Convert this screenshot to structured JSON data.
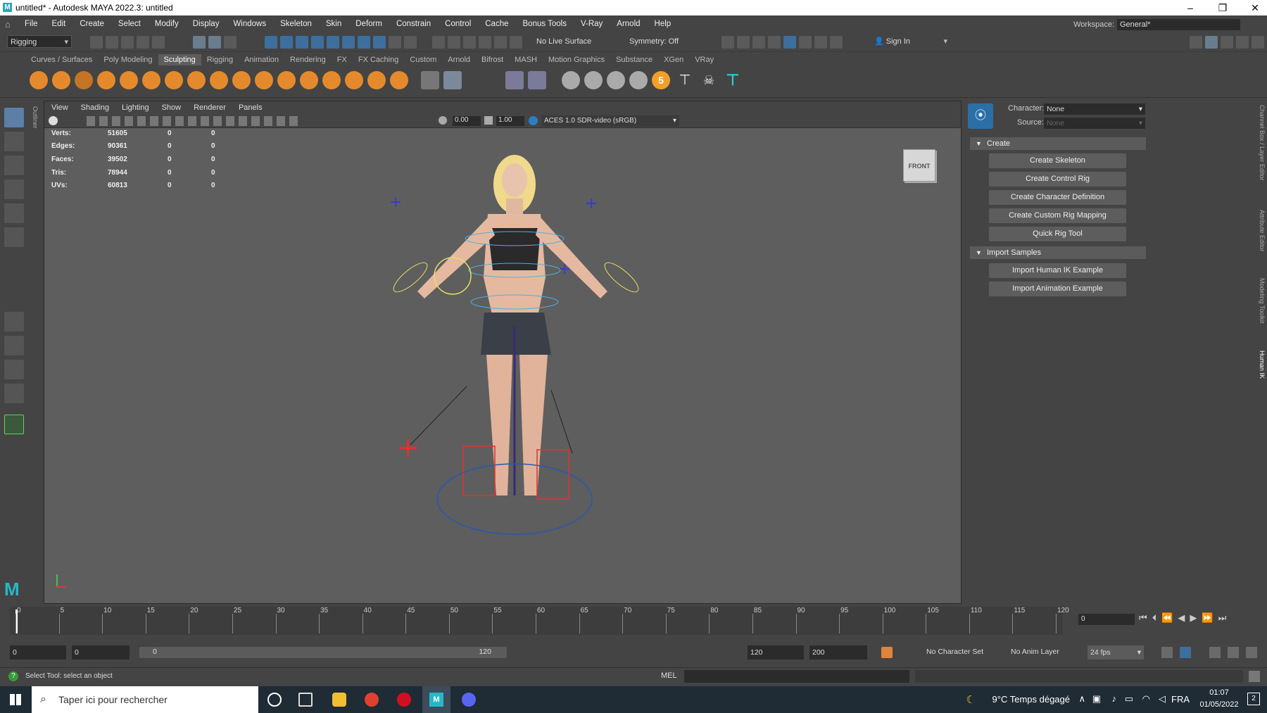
{
  "window": {
    "title": "untitled* - Autodesk MAYA 2022.3: untitled",
    "logo": "M"
  },
  "menu": [
    "File",
    "Edit",
    "Create",
    "Select",
    "Modify",
    "Display",
    "Windows",
    "Skeleton",
    "Skin",
    "Deform",
    "Constrain",
    "Control",
    "Cache",
    "Bonus Tools",
    "V-Ray",
    "Arnold",
    "Help"
  ],
  "workspace": {
    "label": "Workspace:",
    "value": "General*"
  },
  "status": {
    "menuset": "Rigging",
    "live_surface": "No Live Surface",
    "symmetry": "Symmetry: Off",
    "signin": "Sign In"
  },
  "shelf_tabs": [
    "Curves / Surfaces",
    "Poly Modeling",
    "Sculpting",
    "Rigging",
    "Animation",
    "Rendering",
    "FX",
    "FX Caching",
    "Custom",
    "Arnold",
    "Bifrost",
    "MASH",
    "Motion Graphics",
    "Substance",
    "XGen",
    "VRay"
  ],
  "shelf_active": "Sculpting",
  "viewport": {
    "menu": [
      "View",
      "Shading",
      "Lighting",
      "Show",
      "Renderer",
      "Panels"
    ],
    "exposure": "0.00",
    "gamma": "1.00",
    "colorspace": "ACES 1.0 SDR-video (sRGB)",
    "viewcube": "FRONT",
    "hud": [
      {
        "label": "Verts:",
        "v": "51605",
        "a": "0",
        "b": "0"
      },
      {
        "label": "Edges:",
        "v": "90361",
        "a": "0",
        "b": "0"
      },
      {
        "label": "Faces:",
        "v": "39502",
        "a": "0",
        "b": "0"
      },
      {
        "label": "Tris:",
        "v": "78944",
        "a": "0",
        "b": "0"
      },
      {
        "label": "UVs:",
        "v": "60813",
        "a": "0",
        "b": "0"
      }
    ]
  },
  "hik": {
    "character_label": "Character:",
    "character_value": "None",
    "source_label": "Source:",
    "source_value": "None",
    "create_section": "Create",
    "create_buttons": [
      "Create Skeleton",
      "Create Control Rig",
      "Create Character Definition",
      "Create Custom Rig Mapping",
      "Quick Rig Tool"
    ],
    "import_section": "Import Samples",
    "import_buttons": [
      "Import Human IK Example",
      "Import Animation Example"
    ]
  },
  "right_tabs": [
    "Channel Box / Layer Editor",
    "Attribute Editor",
    "Modeling Toolkit",
    "Human IK"
  ],
  "outliner_tab": "Outliner",
  "timeline": {
    "ticks": [
      "0",
      "5",
      "10",
      "15",
      "20",
      "25",
      "30",
      "35",
      "40",
      "45",
      "50",
      "55",
      "60",
      "65",
      "70",
      "75",
      "80",
      "85",
      "90",
      "95",
      "100",
      "105",
      "110",
      "115",
      "120"
    ],
    "current": "0"
  },
  "range": {
    "start": "0",
    "playstart": "0",
    "slider_start": "0",
    "slider_end": "120",
    "playend": "120",
    "end": "200",
    "charset": "No Character Set",
    "animlayer": "No Anim Layer",
    "fps": "24 fps"
  },
  "cmd": {
    "help": "Select Tool: select an object",
    "lang": "MEL"
  },
  "taskbar": {
    "search": "Taper ici pour rechercher",
    "weather": "9°C  Temps dégagé",
    "lang": "FRA",
    "time": "01:07",
    "date": "01/05/2022",
    "notif": "2"
  }
}
